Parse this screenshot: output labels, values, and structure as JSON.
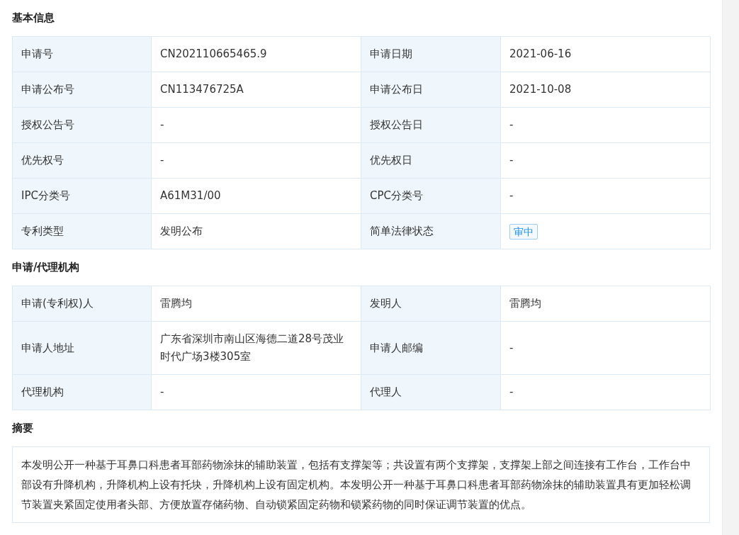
{
  "sections": [
    {
      "kind": "table",
      "title": "基本信息",
      "rows": [
        [
          {
            "label": "申请号",
            "value": "CN202110665465.9"
          },
          {
            "label": "申请日期",
            "value": "2021-06-16"
          }
        ],
        [
          {
            "label": "申请公布号",
            "value": "CN113476725A"
          },
          {
            "label": "申请公布日",
            "value": "2021-10-08"
          }
        ],
        [
          {
            "label": "授权公告号",
            "value": "-"
          },
          {
            "label": "授权公告日",
            "value": "-"
          }
        ],
        [
          {
            "label": "优先权号",
            "value": "-"
          },
          {
            "label": "优先权日",
            "value": "-"
          }
        ],
        [
          {
            "label": "IPC分类号",
            "value": "A61M31/00"
          },
          {
            "label": "CPC分类号",
            "value": "-"
          }
        ],
        [
          {
            "label": "专利类型",
            "value": "发明公布"
          },
          {
            "label": "简单法律状态",
            "value": "审中",
            "kind": "tag"
          }
        ]
      ]
    },
    {
      "kind": "table",
      "title": "申请/代理机构",
      "rows": [
        [
          {
            "label": "申请(专利权)人",
            "value": "雷腾均"
          },
          {
            "label": "发明人",
            "value": "雷腾均"
          }
        ],
        [
          {
            "label": "申请人地址",
            "value": "广东省深圳市南山区海德二道28号茂业时代广场3楼305室"
          },
          {
            "label": "申请人邮编",
            "value": "-"
          }
        ],
        [
          {
            "label": "代理机构",
            "value": "-"
          },
          {
            "label": "代理人",
            "value": "-"
          }
        ]
      ]
    },
    {
      "kind": "text",
      "title": "摘要",
      "text": "本发明公开一种基于耳鼻口科患者耳部药物涂抹的辅助装置，包括有支撑架等；共设置有两个支撑架，支撑架上部之间连接有工作台，工作台中部设有升降机构，升降机构上设有托块，升降机构上设有固定机构。本发明公开一种基于耳鼻口科患者耳部药物涂抹的辅助装置具有更加轻松调节装置夹紧固定使用者头部、方便放置存储药物、自动锁紧固定药物和锁紧药物的同时保证调节装置的优点。"
    }
  ]
}
